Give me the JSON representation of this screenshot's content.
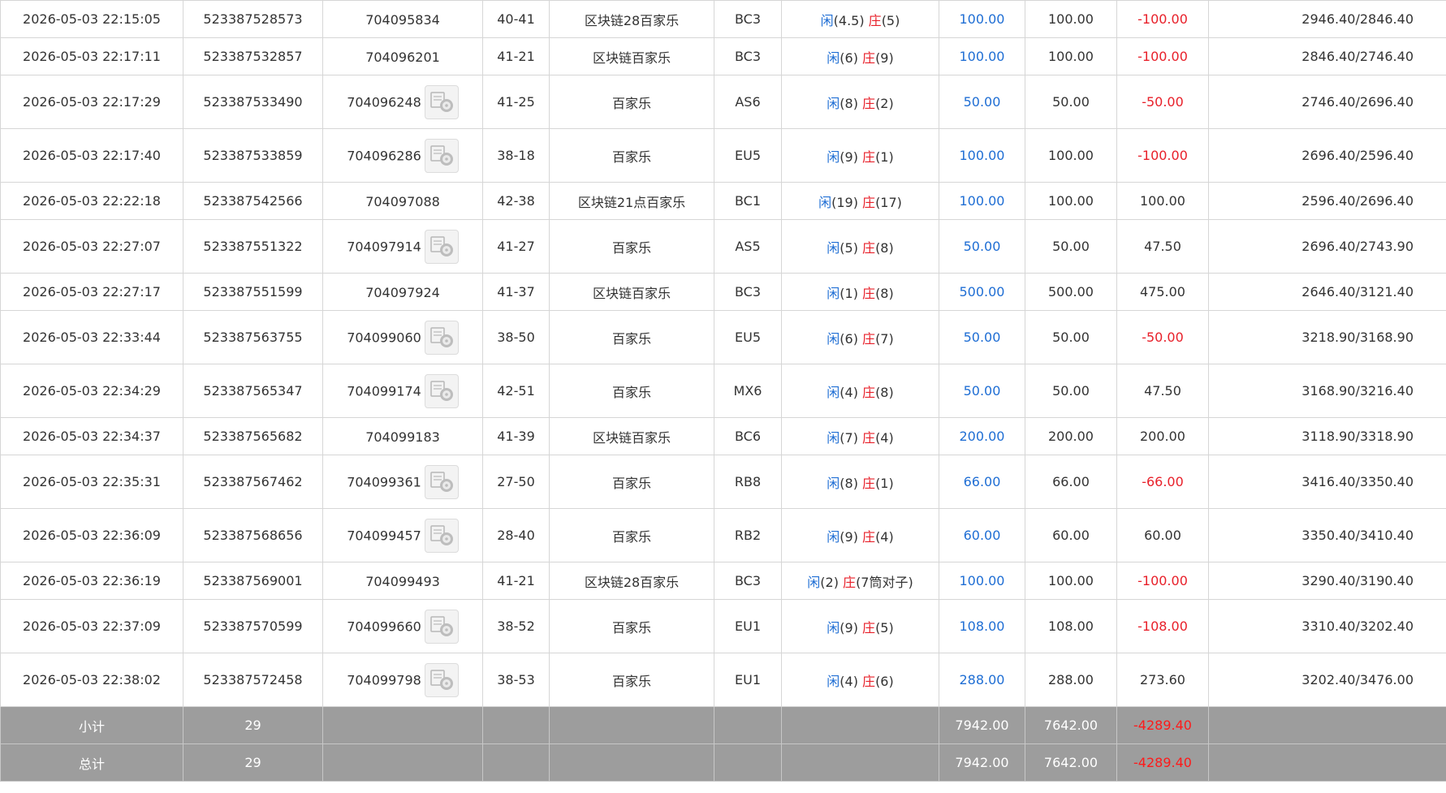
{
  "rows": [
    {
      "time": "2026-05-03 22:15:05",
      "order": "523387528573",
      "game_id": "704095834",
      "video": false,
      "table_no": "40-41",
      "game": "区块链28百家乐",
      "room": "BC3",
      "result": {
        "player": "闲",
        "player_val": "(4.5)",
        "banker": "庄",
        "banker_val": "(5)"
      },
      "bet": "100.00",
      "valid": "100.00",
      "winloss": "-100.00",
      "neg": true,
      "balance": "2946.40/2846.40"
    },
    {
      "time": "2026-05-03 22:17:11",
      "order": "523387532857",
      "game_id": "704096201",
      "video": false,
      "table_no": "41-21",
      "game": "区块链百家乐",
      "room": "BC3",
      "result": {
        "player": "闲",
        "player_val": "(6)",
        "banker": "庄",
        "banker_val": "(9)"
      },
      "bet": "100.00",
      "valid": "100.00",
      "winloss": "-100.00",
      "neg": true,
      "balance": "2846.40/2746.40"
    },
    {
      "time": "2026-05-03 22:17:29",
      "order": "523387533490",
      "game_id": "704096248",
      "video": true,
      "table_no": "41-25",
      "game": "百家乐",
      "room": "AS6",
      "result": {
        "player": "闲",
        "player_val": "(8)",
        "banker": "庄",
        "banker_val": "(2)"
      },
      "bet": "50.00",
      "valid": "50.00",
      "winloss": "-50.00",
      "neg": true,
      "balance": "2746.40/2696.40"
    },
    {
      "time": "2026-05-03 22:17:40",
      "order": "523387533859",
      "game_id": "704096286",
      "video": true,
      "table_no": "38-18",
      "game": "百家乐",
      "room": "EU5",
      "result": {
        "player": "闲",
        "player_val": "(9)",
        "banker": "庄",
        "banker_val": "(1)"
      },
      "bet": "100.00",
      "valid": "100.00",
      "winloss": "-100.00",
      "neg": true,
      "balance": "2696.40/2596.40"
    },
    {
      "time": "2026-05-03 22:22:18",
      "order": "523387542566",
      "game_id": "704097088",
      "video": false,
      "table_no": "42-38",
      "game": "区块链21点百家乐",
      "room": "BC1",
      "result": {
        "player": "闲",
        "player_val": "(19)",
        "banker": "庄",
        "banker_val": "(17)"
      },
      "bet": "100.00",
      "valid": "100.00",
      "winloss": "100.00",
      "neg": false,
      "balance": "2596.40/2696.40"
    },
    {
      "time": "2026-05-03 22:27:07",
      "order": "523387551322",
      "game_id": "704097914",
      "video": true,
      "table_no": "41-27",
      "game": "百家乐",
      "room": "AS5",
      "result": {
        "player": "闲",
        "player_val": "(5)",
        "banker": "庄",
        "banker_val": "(8)"
      },
      "bet": "50.00",
      "valid": "50.00",
      "winloss": "47.50",
      "neg": false,
      "balance": "2696.40/2743.90"
    },
    {
      "time": "2026-05-03 22:27:17",
      "order": "523387551599",
      "game_id": "704097924",
      "video": false,
      "table_no": "41-37",
      "game": "区块链百家乐",
      "room": "BC3",
      "result": {
        "player": "闲",
        "player_val": "(1)",
        "banker": "庄",
        "banker_val": "(8)"
      },
      "bet": "500.00",
      "valid": "500.00",
      "winloss": "475.00",
      "neg": false,
      "balance": "2646.40/3121.40"
    },
    {
      "time": "2026-05-03 22:33:44",
      "order": "523387563755",
      "game_id": "704099060",
      "video": true,
      "table_no": "38-50",
      "game": "百家乐",
      "room": "EU5",
      "result": {
        "player": "闲",
        "player_val": "(6)",
        "banker": "庄",
        "banker_val": "(7)"
      },
      "bet": "50.00",
      "valid": "50.00",
      "winloss": "-50.00",
      "neg": true,
      "balance": "3218.90/3168.90"
    },
    {
      "time": "2026-05-03 22:34:29",
      "order": "523387565347",
      "game_id": "704099174",
      "video": true,
      "table_no": "42-51",
      "game": "百家乐",
      "room": "MX6",
      "result": {
        "player": "闲",
        "player_val": "(4)",
        "banker": "庄",
        "banker_val": "(8)"
      },
      "bet": "50.00",
      "valid": "50.00",
      "winloss": "47.50",
      "neg": false,
      "balance": "3168.90/3216.40"
    },
    {
      "time": "2026-05-03 22:34:37",
      "order": "523387565682",
      "game_id": "704099183",
      "video": false,
      "table_no": "41-39",
      "game": "区块链百家乐",
      "room": "BC6",
      "result": {
        "player": "闲",
        "player_val": "(7)",
        "banker": "庄",
        "banker_val": "(4)"
      },
      "bet": "200.00",
      "valid": "200.00",
      "winloss": "200.00",
      "neg": false,
      "balance": "3118.90/3318.90"
    },
    {
      "time": "2026-05-03 22:35:31",
      "order": "523387567462",
      "game_id": "704099361",
      "video": true,
      "table_no": "27-50",
      "game": "百家乐",
      "room": "RB8",
      "result": {
        "player": "闲",
        "player_val": "(8)",
        "banker": "庄",
        "banker_val": "(1)"
      },
      "bet": "66.00",
      "valid": "66.00",
      "winloss": "-66.00",
      "neg": true,
      "balance": "3416.40/3350.40"
    },
    {
      "time": "2026-05-03 22:36:09",
      "order": "523387568656",
      "game_id": "704099457",
      "video": true,
      "table_no": "28-40",
      "game": "百家乐",
      "room": "RB2",
      "result": {
        "player": "闲",
        "player_val": "(9)",
        "banker": "庄",
        "banker_val": "(4)"
      },
      "bet": "60.00",
      "valid": "60.00",
      "winloss": "60.00",
      "neg": false,
      "balance": "3350.40/3410.40"
    },
    {
      "time": "2026-05-03 22:36:19",
      "order": "523387569001",
      "game_id": "704099493",
      "video": false,
      "table_no": "41-21",
      "game": "区块链28百家乐",
      "room": "BC3",
      "result": {
        "player": "闲",
        "player_val": "(2)",
        "banker": "庄",
        "banker_val": "(7筒对子)"
      },
      "bet": "100.00",
      "valid": "100.00",
      "winloss": "-100.00",
      "neg": true,
      "balance": "3290.40/3190.40"
    },
    {
      "time": "2026-05-03 22:37:09",
      "order": "523387570599",
      "game_id": "704099660",
      "video": true,
      "table_no": "38-52",
      "game": "百家乐",
      "room": "EU1",
      "result": {
        "player": "闲",
        "player_val": "(9)",
        "banker": "庄",
        "banker_val": "(5)"
      },
      "bet": "108.00",
      "valid": "108.00",
      "winloss": "-108.00",
      "neg": true,
      "balance": "3310.40/3202.40"
    },
    {
      "time": "2026-05-03 22:38:02",
      "order": "523387572458",
      "game_id": "704099798",
      "video": true,
      "table_no": "38-53",
      "game": "百家乐",
      "room": "EU1",
      "result": {
        "player": "闲",
        "player_val": "(4)",
        "banker": "庄",
        "banker_val": "(6)"
      },
      "bet": "288.00",
      "valid": "288.00",
      "winloss": "273.60",
      "neg": false,
      "balance": "3202.40/3476.00"
    }
  ],
  "subtotal": {
    "label": "小计",
    "count": "29",
    "bet": "7942.00",
    "valid": "7642.00",
    "winloss": "-4289.40"
  },
  "total": {
    "label": "总计",
    "count": "29",
    "bet": "7942.00",
    "valid": "7642.00",
    "winloss": "-4289.40"
  },
  "icons": {
    "video": "video-replay-icon"
  },
  "colors": {
    "player": "#1f6ed4",
    "banker": "#e8202a",
    "summary_bg": "#9d9d9d"
  }
}
